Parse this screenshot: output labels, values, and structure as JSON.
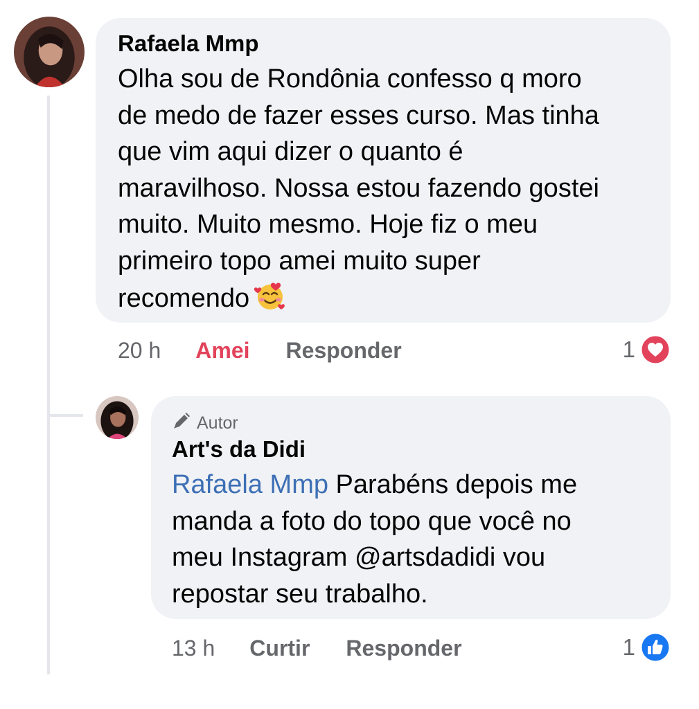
{
  "comments": [
    {
      "author": "Rafaela Mmp",
      "text": "Olha sou de Rondônia confesso q moro\nde medo de fazer esses curso. Mas tinha\nque vim aqui dizer o quanto é\nmaravilhoso. Nossa estou fazendo gostei\nmuito. Muito mesmo. Hoje fiz o meu\nprimeiro topo amei muito super\nrecomendo",
      "emoji": "smiling-face-with-hearts",
      "time": "20 h",
      "reaction_label": "Amei",
      "reply_label": "Responder",
      "reaction_count": "1",
      "reaction_icon": "heart-icon",
      "reaction_color": "#e2435b"
    },
    {
      "badge": "Autor",
      "badge_icon": "pen-icon",
      "author": "Art's da Didi",
      "mention": "Rafaela Mmp",
      "text": " Parabéns depois me\nmanda a foto do topo que você no\nmeu Instagram @artsdadidi vou\nrepostar seu trabalho.",
      "time": "13 h",
      "reaction_label": "Curtir",
      "reply_label": "Responder",
      "reaction_count": "1",
      "reaction_icon": "like-icon",
      "reaction_color": "#1877f2"
    }
  ],
  "colors": {
    "bubble": "#f0f2f5",
    "meta_text": "#65676b",
    "mention": "#3d6fb5",
    "thread_line": "#e4e6eb"
  }
}
